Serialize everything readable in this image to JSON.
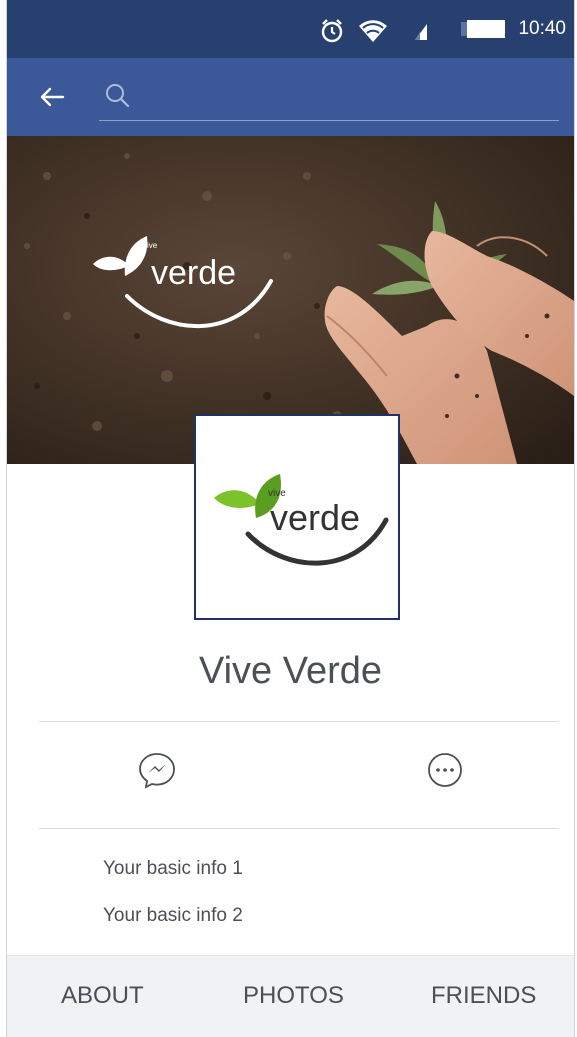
{
  "status_bar": {
    "time": "10:40",
    "icons": [
      "alarm-icon",
      "wifi-icon",
      "signal-icon",
      "battery-icon"
    ]
  },
  "search": {
    "placeholder": "",
    "icons": [
      "back-arrow-icon",
      "search-icon"
    ]
  },
  "cover": {
    "logo_text": "verde",
    "logo_small_text": "vive"
  },
  "profile": {
    "avatar_logo_text": "verde",
    "avatar_logo_small_text": "vive",
    "name": "Vive Verde"
  },
  "actions": [
    {
      "icon": "messenger-icon"
    },
    {
      "icon": "more-icon"
    }
  ],
  "basic_info": [
    "Your basic info 1",
    "Your basic info 2"
  ],
  "tabs": {
    "about": "ABOUT",
    "photos": "PHOTOS",
    "friends": "FRIENDS"
  },
  "colors": {
    "status_bar": "#27406f",
    "header": "#3b5998",
    "leaf_green": "#7cc22b",
    "text_gray": "#4b4f56"
  }
}
